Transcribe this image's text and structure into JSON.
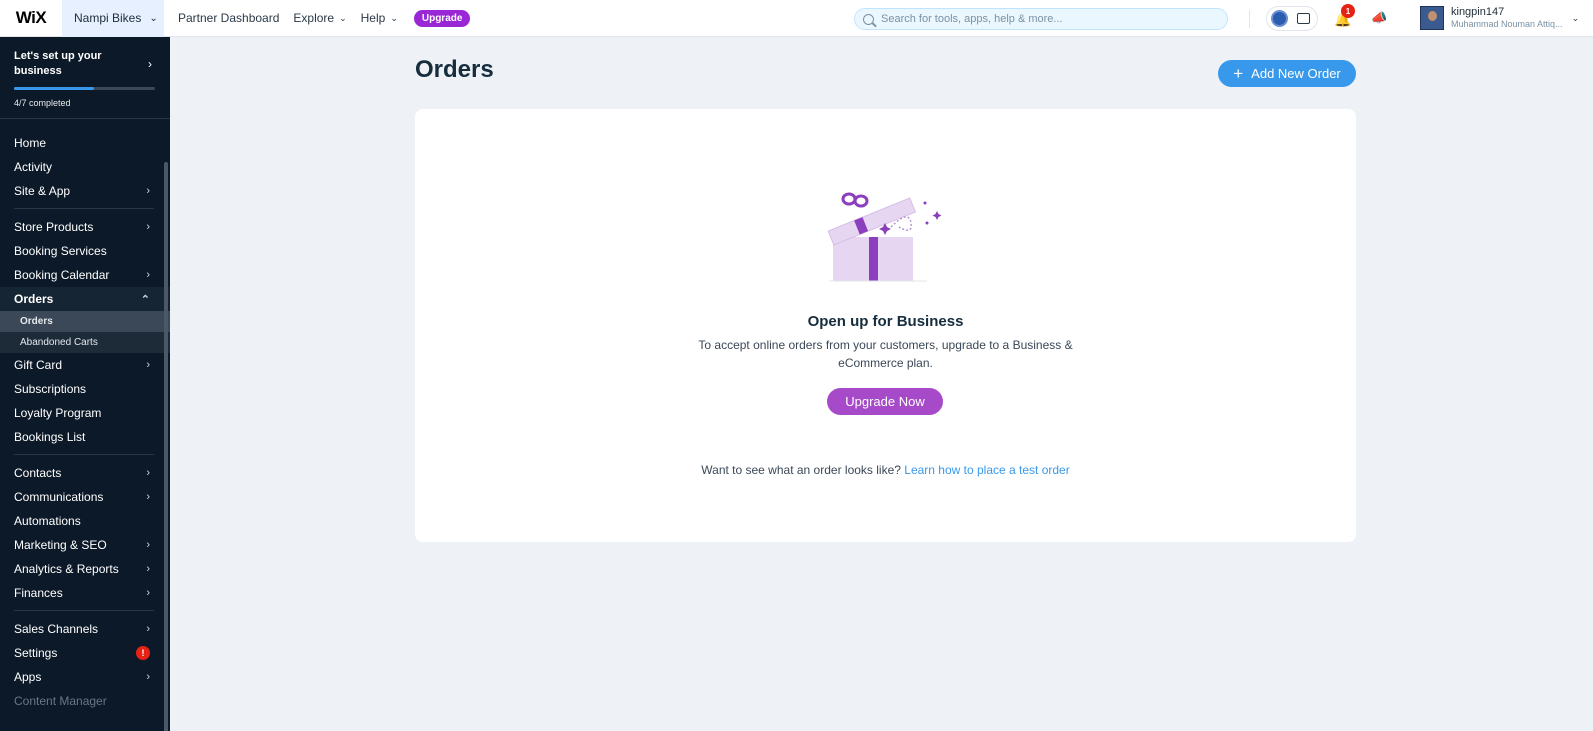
{
  "topbar": {
    "logo": "WiX",
    "site_name": "Nampi Bikes",
    "nav": {
      "partner": "Partner Dashboard",
      "explore": "Explore",
      "help": "Help",
      "upgrade": "Upgrade"
    },
    "search_placeholder": "Search for tools, apps, help & more...",
    "notifications_count": "1",
    "user": {
      "username": "kingpin147",
      "full_name": "Muhammad Nouman Attiq..."
    }
  },
  "sidebar": {
    "setup": {
      "title": "Let's set up your business",
      "progress_label": "4/7 completed",
      "progress": 0.57
    },
    "items": {
      "home": "Home",
      "activity": "Activity",
      "site_app": "Site & App",
      "store_products": "Store Products",
      "booking_services": "Booking Services",
      "booking_calendar": "Booking Calendar",
      "orders": "Orders",
      "orders_sub": "Orders",
      "abandoned_carts": "Abandoned Carts",
      "gift_card": "Gift Card",
      "subscriptions": "Subscriptions",
      "loyalty_program": "Loyalty Program",
      "bookings_list": "Bookings List",
      "contacts": "Contacts",
      "communications": "Communications",
      "automations": "Automations",
      "marketing_seo": "Marketing & SEO",
      "analytics_reports": "Analytics & Reports",
      "finances": "Finances",
      "sales_channels": "Sales Channels",
      "settings": "Settings",
      "apps": "Apps",
      "content_manager": "Content Manager"
    },
    "settings_alert": "!"
  },
  "main": {
    "title": "Orders",
    "add_button": "Add New Order",
    "empty": {
      "title": "Open up for Business",
      "description": "To accept online orders from your customers, upgrade to a Business & eCommerce plan.",
      "upgrade_button": "Upgrade Now",
      "test_prompt": "Want to see what an order looks like?",
      "test_link": "Learn how to place a test order"
    }
  },
  "colors": {
    "accent": "#3899ec",
    "upgrade": "#a64ac9",
    "sidebar_bg": "#0c1928",
    "page_bg": "#eef2f6"
  }
}
